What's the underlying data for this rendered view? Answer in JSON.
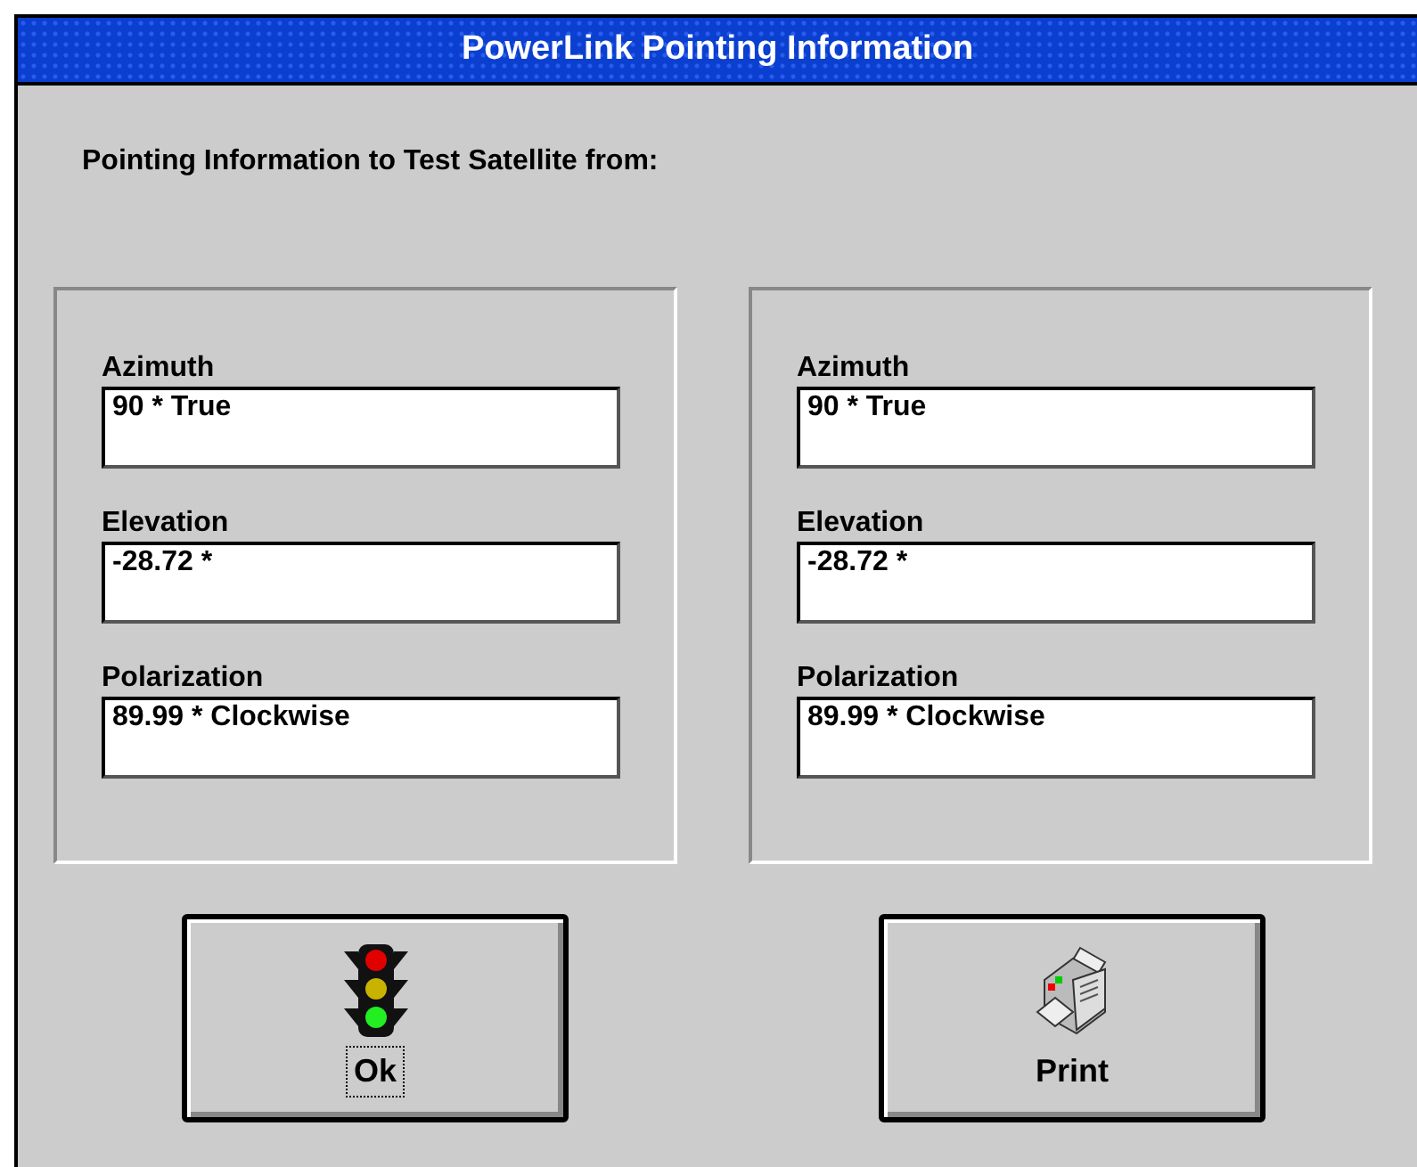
{
  "window": {
    "title": "PowerLink Pointing Information"
  },
  "heading": "Pointing Information to Test Satellite from:",
  "panels": [
    {
      "fields": [
        {
          "label": "Azimuth",
          "value": "90 * True"
        },
        {
          "label": "Elevation",
          "value": "-28.72 *"
        },
        {
          "label": "Polarization",
          "value": "89.99 * Clockwise"
        }
      ]
    },
    {
      "fields": [
        {
          "label": "Azimuth",
          "value": "90 * True"
        },
        {
          "label": "Elevation",
          "value": "-28.72 *"
        },
        {
          "label": "Polarization",
          "value": "89.99 * Clockwise"
        }
      ]
    }
  ],
  "buttons": [
    {
      "kind": "traffic-light",
      "label": "Ok",
      "focused": true
    },
    {
      "kind": "printer",
      "label": "Print",
      "focused": false
    }
  ]
}
